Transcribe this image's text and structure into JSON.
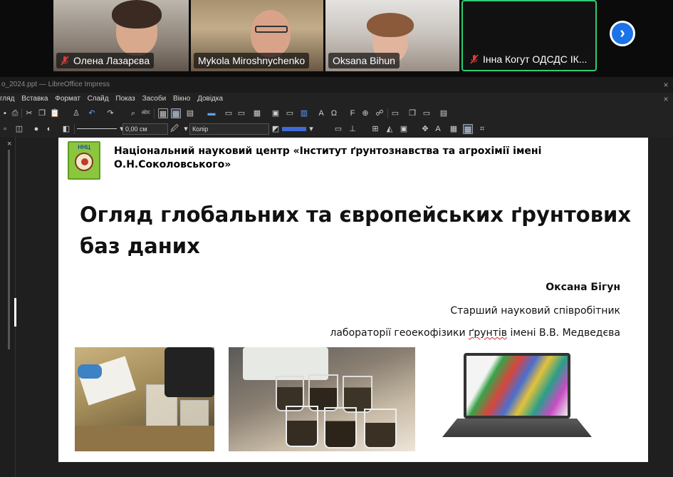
{
  "meeting": {
    "participants": [
      {
        "name": "Олена Лазарєва",
        "muted": true
      },
      {
        "name": "Mykola Miroshnychenko",
        "muted": false
      },
      {
        "name": "Oksana Bihun",
        "muted": false
      },
      {
        "name": "Інна Когут ОДСДС ІК...",
        "muted": true,
        "active_speaker": true
      }
    ],
    "next_icon": "chevron-right-icon",
    "active_border_color": "#2ecc71",
    "next_button_color": "#1a73e8"
  },
  "app": {
    "title": "o_2024.ppt — LibreOffice Impress",
    "menu": [
      "гляд",
      "Вставка",
      "Формат",
      "Слайд",
      "Показ",
      "Засоби",
      "Вікно",
      "Довідка"
    ],
    "line_width_value": "0,00 см",
    "area_fill_value": "Колір",
    "panel_close": "×"
  },
  "slide": {
    "org_name": "Національний науковий центр «Інститут ґрунтознавства та агрохімії імені О.Н.Соколовського»",
    "logo_text": "ННЦ",
    "title": "Огляд глобальних та європейських ґрунтових баз даних",
    "author": "Оксана Бігун",
    "position_line1": "Старший науковий співробітник",
    "position_line2_prefix": "лабораторії геоекофізики ",
    "position_line2_misspelled": "ґрунтів",
    "position_line2_suffix": " імені В.В. Медведєва",
    "photos": [
      "soil-sampling-photo",
      "lab-beakers-photo",
      "laptop-gis-map-photo"
    ]
  }
}
